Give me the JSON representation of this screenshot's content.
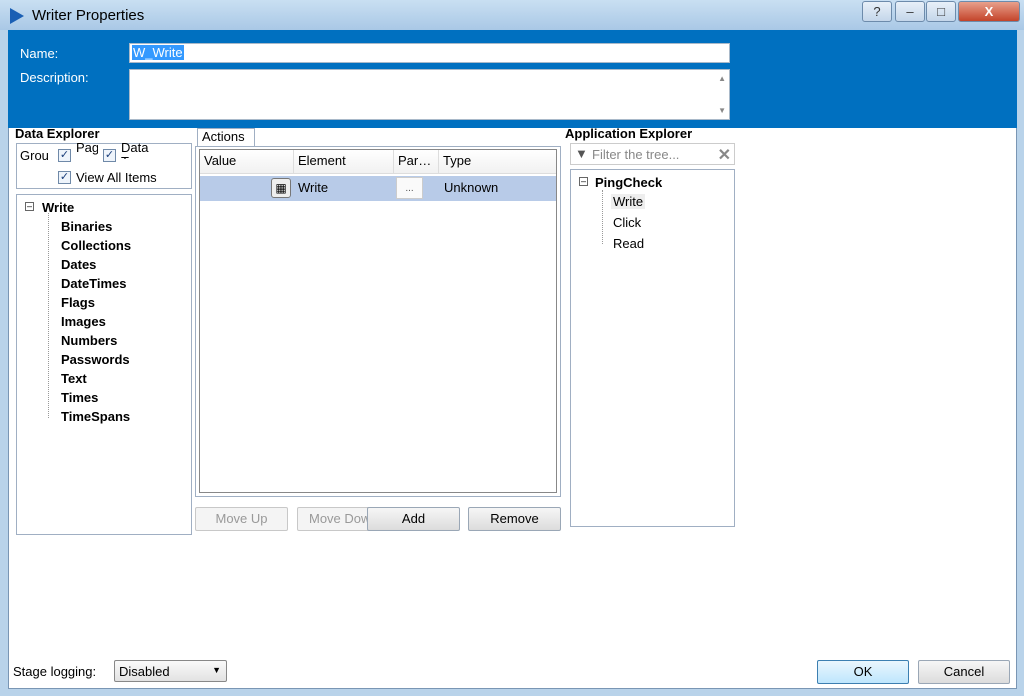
{
  "window": {
    "title": "Writer Properties",
    "help": "?",
    "minimize": "–",
    "maximize": "□",
    "close": "X"
  },
  "header": {
    "name_label": "Name:",
    "name_value": "W_Write",
    "description_label": "Description:",
    "description_value": ""
  },
  "data_explorer": {
    "title": "Data Explorer",
    "group_label": "Grou",
    "page_label": "Pag e",
    "data_type_label": "Data Type",
    "view_all_label": "View All Items",
    "tree_root": "Write",
    "items": [
      "Binaries",
      "Collections",
      "Dates",
      "DateTimes",
      "Flags",
      "Images",
      "Numbers",
      "Passwords",
      "Text",
      "Times",
      "TimeSpans"
    ]
  },
  "actions": {
    "tab": "Actions",
    "columns": [
      "Value",
      "Element",
      "Par…",
      "Type"
    ],
    "rows": [
      {
        "value": "",
        "element": "Write",
        "params": "...",
        "type": "Unknown"
      }
    ],
    "move_up": "Move Up",
    "move_down": "Move Down",
    "add": "Add",
    "remove": "Remove"
  },
  "app_explorer": {
    "title": "Application Explorer",
    "filter_placeholder": "Filter the tree...",
    "root": "PingCheck",
    "items": [
      "Write",
      "Click",
      "Read"
    ]
  },
  "footer": {
    "stage_logging_label": "Stage logging:",
    "stage_logging_value": "Disabled",
    "ok": "OK",
    "cancel": "Cancel"
  }
}
